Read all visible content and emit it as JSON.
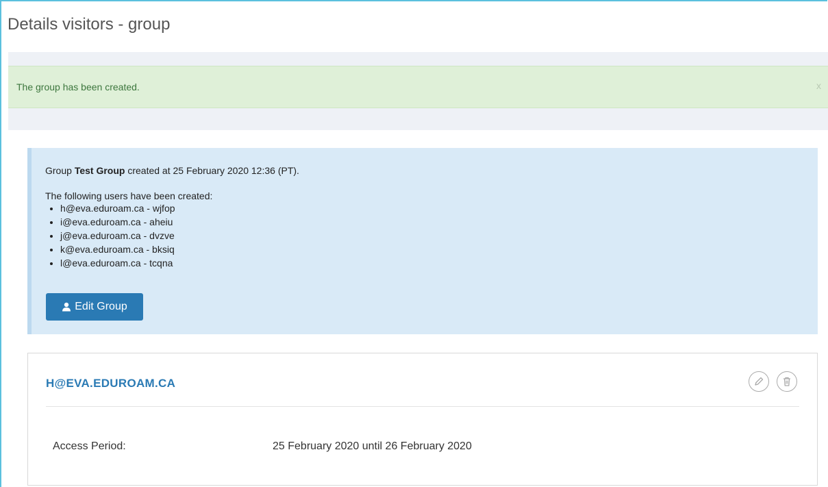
{
  "page": {
    "title": "Details visitors - group"
  },
  "alert": {
    "message": "The group has been created.",
    "close_label": "x"
  },
  "info": {
    "prefix": "Group ",
    "group_name": "Test Group",
    "suffix": " created at 25 February 2020 12:36 (PT).",
    "users_heading": "The following users have been created:",
    "users": [
      "h@eva.eduroam.ca - wjfop",
      "i@eva.eduroam.ca - aheiu",
      "j@eva.eduroam.ca - dvzve",
      "k@eva.eduroam.ca - bksiq",
      "l@eva.eduroam.ca - tcqna"
    ],
    "edit_button": {
      "label": "Edit Group",
      "icon": "user-icon"
    }
  },
  "card": {
    "title": "H@EVA.EDUROAM.CA",
    "actions": [
      {
        "icon": "pencil-icon"
      },
      {
        "icon": "trash-icon"
      }
    ],
    "fields": [
      {
        "label": "Access Period:",
        "value": "25 February 2020 until 26 February 2020"
      }
    ]
  },
  "colors": {
    "accent": "#2a7ab4",
    "alert_bg": "#dff0d8",
    "alert_text": "#3c763d",
    "info_bg": "#d9eaf7"
  }
}
